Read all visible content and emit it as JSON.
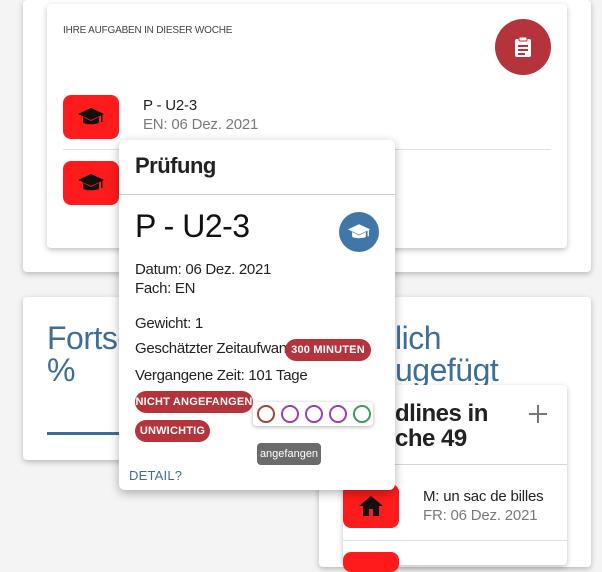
{
  "tasks_card": {
    "header": "IHRE AUFGABEN IN DIESER WOCHE",
    "icon": "clipboard-icon",
    "items": [
      {
        "title": "P - U2-3",
        "subtitle": "EN: 06 Dez. 2021",
        "icon": "graduation-cap-icon"
      },
      {
        "title": "",
        "subtitle": "",
        "icon": "graduation-cap-icon"
      }
    ]
  },
  "progress_card": {
    "title_partial": "Fortsc",
    "value_partial": "%"
  },
  "deadlines_card": {
    "title_partial_1": "lich",
    "title_partial_2": "ugefügt",
    "subcard_title_line1": "dlines in",
    "subcard_title_line2": "che 49",
    "add_icon": "plus-icon",
    "items": [
      {
        "title": "M: un sac de billes",
        "subtitle": "FR: 06 Dez. 2021",
        "icon": "home-icon"
      }
    ]
  },
  "popover": {
    "header": "Prüfung",
    "title": "P - U2-3",
    "date_line": "Datum: 06 Dez. 2021",
    "subject_line": "Fach: EN",
    "weight_line": "Gewicht: 1",
    "effort_label": "Geschätzter Zeitaufwand:",
    "effort_badge": "300 MINUTEN",
    "elapsed_line": "Vergangene Zeit: 101 Tage",
    "status_badge": "NICHT ANGEFANGEN",
    "importance_badge": "UNWICHTIG",
    "progress_tooltip": "angefangen",
    "progress_colors": [
      "#a0443c",
      "#9b3fb5",
      "#9b3fb5",
      "#9b3fb5",
      "#3c9a5f"
    ],
    "detail_link": "DETAIL?"
  },
  "colors": {
    "accent_blue": "#3e6e96",
    "badge_red": "#b5333a",
    "icon_red": "#ff1b1b",
    "popover_icon_blue": "#3f78a8"
  }
}
